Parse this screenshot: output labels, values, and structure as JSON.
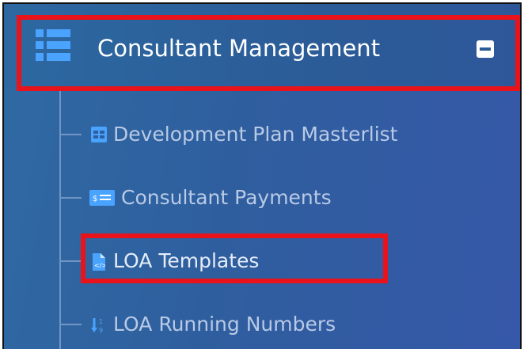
{
  "menu": {
    "header": {
      "title": "Consultant Management",
      "icon": "list-icon",
      "collapse_icon": "minus-square-icon"
    },
    "items": [
      {
        "label": "Development Plan Masterlist",
        "icon": "table-icon"
      },
      {
        "label": "Consultant Payments",
        "icon": "money-card-icon"
      },
      {
        "label": "LOA Templates",
        "icon": "code-file-icon"
      },
      {
        "label": "LOA Running Numbers",
        "icon": "sort-numeric-icon"
      }
    ]
  },
  "colors": {
    "sidebar_bg": "#2f5e9e",
    "header_bg": "#2b5c98",
    "highlight": "#e8131b",
    "accent_icon": "#4aa3ff",
    "menu_text": "#b8cae6"
  }
}
